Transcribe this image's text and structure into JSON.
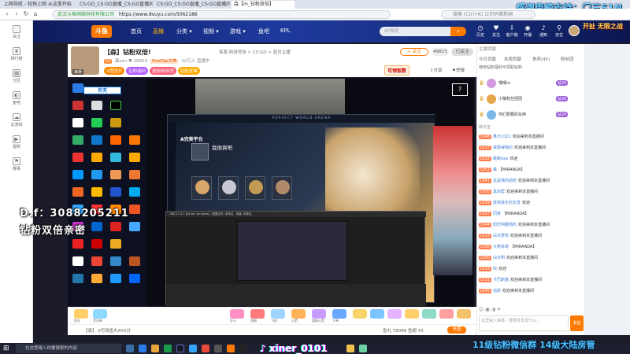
{
  "browser": {
    "tabs": [
      {
        "label": "上网导航 - 轻快上网 从这里开始",
        "active": false
      },
      {
        "label": "CS:GO_CS:GO直播_CS:GO直播间",
        "active": false
      },
      {
        "label": "CS:GO_CS:GO直播_CS:GO直播间",
        "active": false
      },
      {
        "label": "森【m_钻粉双倍】",
        "active": true
      }
    ],
    "secure_label": "武汉斗鱼网络科技有限公司",
    "url": "https://www.douyu.com/5062186",
    "search_placeholder": "搜索 (Ctrl+K) 公司同事新闻"
  },
  "overlay": {
    "top_right": "感谢周榜支持：门三S1N",
    "left_line1": "D.f：3088205211",
    "left_line2": "钻粉双倍亲密",
    "taskbar_center": "xiner_0101",
    "bottom_right": "11级钻粉微信群 14级大陆房管"
  },
  "leftbar": {
    "items": [
      "关注",
      "排行榜",
      "分区",
      "鱼吧",
      "云游戏",
      "视频",
      "赛事"
    ]
  },
  "douyu_nav": {
    "logo": "斗鱼",
    "items": [
      {
        "label": "首页",
        "active": false
      },
      {
        "label": "直播",
        "active": true
      },
      {
        "label": "分类 ▾",
        "active": false
      },
      {
        "label": "视频 ▾",
        "active": false
      },
      {
        "label": "游戏 ▾",
        "active": false
      },
      {
        "label": "鱼吧",
        "active": false
      },
      {
        "label": "KPL",
        "active": false
      }
    ],
    "search_placeholder": "dr探班",
    "right_icons": [
      "历史",
      "关注",
      "客户端",
      "开播",
      "通知",
      "定位"
    ],
    "promo": "开扯 无限之战"
  },
  "room": {
    "avatar_label": "森娱",
    "title": "【森】钻粉双倍!",
    "categories": "客服  网游竞技 > CS:GO > 蓝白主播",
    "meta": {
      "level": "LV",
      "anchor": "森sen",
      "fans": "28950",
      "tag": "OneTap大神",
      "viewers": "22万人",
      "status": "直播中"
    },
    "badges": [
      {
        "label": "V团团长",
        "color": "#ff8a00"
      },
      {
        "label": "钻粉福利",
        "color": "#b05cff"
      },
      {
        "label": "超级粉丝团",
        "color": "#ff5e7a"
      },
      {
        "label": "钻粉宝典",
        "color": "#ffaa00"
      }
    ],
    "follow_label": "+ 关注",
    "follow_count": "49823",
    "follow2": "已关注",
    "promo_banner": "可领饭数",
    "share_label": "分享",
    "report_label": "举报"
  },
  "video": {
    "side_button": "许天",
    "question": "?",
    "app_topbar": "PERFECT WORLD ARENA",
    "app_logo": "A完美平台",
    "app_yell": "我很爽吧",
    "obs_title": "OBS 27.0.1 (64-bit, windows) - 配置文件: 未命名 - 场景: 未命名"
  },
  "giftbar": {
    "items": [
      "鱼丸",
      "荧光棒",
      "办卡",
      "鱼翅",
      "飞机",
      "火箭",
      "超级火箭",
      "下单"
    ]
  },
  "statusbar": {
    "left": "【录】 0可用鱼丸4X0分",
    "right": "鱼丸 78088  鱼翅 43",
    "record": "充值"
  },
  "rightpanel": {
    "rank_head": "主播贡献",
    "tabs": [
      "今日贡献",
      "本周贡献",
      "贵宾(45)",
      "粉丝团"
    ],
    "notice": "使用钻粉福利可领取钻粉",
    "ranks": [
      {
        "name": "嘿嘿ro",
        "badge": "钻20",
        "color": "#d19ae0"
      },
      {
        "name": "小敬粉丝团团",
        "badge": "钻20",
        "color": "#e6a54a"
      },
      {
        "name": "你们想要的东西",
        "badge": "钻20",
        "color": "#7bb6e8"
      }
    ],
    "viewers": "聊天室",
    "chat": [
      {
        "lv": "LV48",
        "user": "某大1022",
        "text": "欢迎来到本直播间"
      },
      {
        "lv": "LV37",
        "user": "卑碰得我的",
        "text": "欢迎来到本直播间"
      },
      {
        "lv": "LV22",
        "user": "跳跳daa",
        "text": "欢迎"
      },
      {
        "lv": "LV52",
        "user": "森",
        "text": "【MIRANDA】"
      },
      {
        "lv": "LV41",
        "user": "这是我的钻粉",
        "text": "欢迎来到本直播间"
      },
      {
        "lv": "LV30",
        "user": "黑鸡帮",
        "text": "欢迎来到本直播间"
      },
      {
        "lv": "LV39",
        "user": "逐渐进化时长发",
        "text": "欢迎"
      },
      {
        "lv": "LV27",
        "user": "同意",
        "text": "【MIRANDA】"
      },
      {
        "lv": "LV44",
        "user": "阳光明媚地的",
        "text": "欢迎来到本直播间"
      },
      {
        "lv": "LV18",
        "user": "白日梦想",
        "text": "欢迎来到本直播间"
      },
      {
        "lv": "LV36",
        "user": "大佬哥哥",
        "text": "【MIRANDA】"
      },
      {
        "lv": "LV50",
        "user": "白日明",
        "text": "欢迎来到本直播间"
      },
      {
        "lv": "LV33",
        "user": "吗",
        "text": "欢迎"
      },
      {
        "lv": "LV21",
        "user": "卡巴斯基",
        "text": "欢迎来到本直播间"
      },
      {
        "lv": "LV45",
        "user": "钻粉",
        "text": "欢迎来到本直播间"
      }
    ],
    "input_placeholder": "这里输入弹幕，要要变发发什么...",
    "send_label": "发送"
  },
  "taskbar": {
    "search_placeholder": "在这里输入你要搜索的内容"
  }
}
